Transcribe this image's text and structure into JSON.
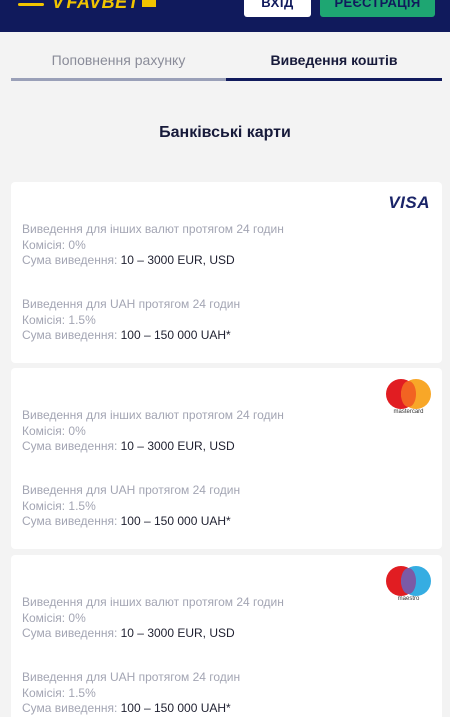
{
  "header": {
    "logo_text": "FAVBET",
    "login_label": "ВХІД",
    "register_label": "РЕЄСТРАЦІЯ"
  },
  "tabs": [
    {
      "label": "Поповнення рахунку",
      "active": false
    },
    {
      "label": "Виведення коштів",
      "active": true
    }
  ],
  "section_title": "Банківські карти",
  "cards": [
    {
      "brand": "VISA",
      "blocks": [
        {
          "line1": "Виведення для інших валют протягом 24 годин",
          "fee_label": "Комісія: 0%",
          "amount_label": "Сума виведення: ",
          "amount_value": "10 – 3000 EUR, USD"
        },
        {
          "line1": "Виведення для UAH протягом 24 годин",
          "fee_label": "Комісія: 1.5%",
          "amount_label": "Сума виведення: ",
          "amount_value": "100 – 150 000 UAH*"
        }
      ]
    },
    {
      "brand": "mastercard",
      "blocks": [
        {
          "line1": "Виведення для інших валют протягом 24 годин",
          "fee_label": "Комісія: 0%",
          "amount_label": "Сума виведення: ",
          "amount_value": "10 – 3000 EUR, USD"
        },
        {
          "line1": "Виведення для UAH протягом 24 годин",
          "fee_label": "Комісія: 1.5%",
          "amount_label": "Сума виведення: ",
          "amount_value": "100 – 150 000 UAH*"
        }
      ]
    },
    {
      "brand": "maestro",
      "blocks": [
        {
          "line1": "Виведення для інших валют протягом 24 годин",
          "fee_label": "Комісія: 0%",
          "amount_label": "Сума виведення: ",
          "amount_value": "10 – 3000 EUR, USD"
        },
        {
          "line1": "Виведення для UAH протягом 24 годин",
          "fee_label": "Комісія: 1.5%",
          "amount_label": "Сума виведення: ",
          "amount_value": "100 – 150 000 UAH*"
        }
      ]
    }
  ],
  "colors": {
    "header_bg": "#101a5c",
    "accent_yellow": "#f1c400",
    "register_green": "#1ea672",
    "page_bg": "#f3f3f3"
  }
}
